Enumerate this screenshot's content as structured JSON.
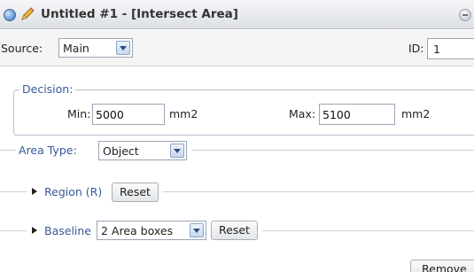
{
  "window": {
    "title": "Untitled #1 - [Intersect Area]"
  },
  "source": {
    "label": "Source:",
    "selected": "Main",
    "id_label": "ID:",
    "id_value": "1"
  },
  "decision": {
    "legend": "Decision:",
    "min_label": "Min:",
    "min_value": "5000",
    "min_unit": "mm2",
    "max_label": "Max:",
    "max_value": "5100",
    "max_unit": "mm2"
  },
  "area_type": {
    "label": "Area Type:",
    "selected": "Object"
  },
  "region": {
    "label": "Region (R)",
    "reset_label": "Reset"
  },
  "baseline": {
    "label": "Baseline",
    "selected": "2 Area boxes",
    "reset_label": "Reset"
  },
  "footer": {
    "remove_label": "Remove"
  },
  "colors": {
    "section_label": "#355a9a",
    "divider": "#c9d0da"
  }
}
